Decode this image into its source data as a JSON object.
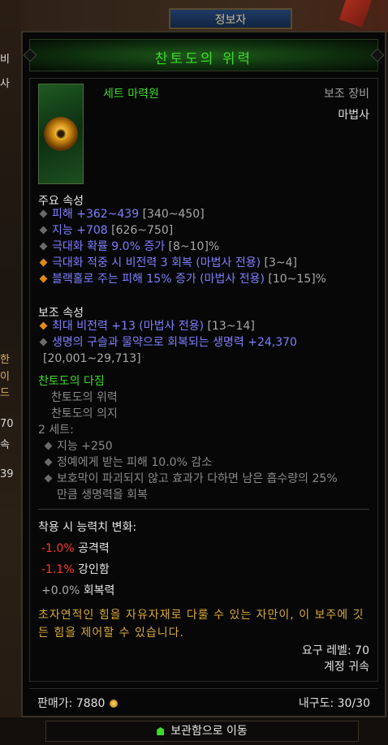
{
  "background": {
    "top_button": "정보자",
    "left_partial": [
      "비",
      "사",
      "한",
      "이",
      "드",
      "70",
      "속",
      "39"
    ]
  },
  "item": {
    "name": "찬토도의 위력",
    "type": "세트 마력원",
    "slot": "보조 장비",
    "class": "마법사"
  },
  "primary": {
    "header": "주요 속성",
    "stats": [
      {
        "value": "피해 +362~439",
        "range": " [340~450]"
      },
      {
        "value": "지능 +708",
        "range": " [626~750]"
      },
      {
        "value": "극대화 확률 9.0% 증가",
        "range": " [8~10]%"
      },
      {
        "value": "극대화 적중 시 비전력 3 회복 (마법사 전용)",
        "range": " [3~4]"
      },
      {
        "value": "블랙홀로 주는 피해 15% 증가 (마법사 전용)",
        "range": " [10~15]%"
      }
    ]
  },
  "secondary": {
    "header": "보조 속성",
    "stats": [
      {
        "value": "최대 비전력 +13 (마법사 전용)",
        "range": " [13~14]"
      },
      {
        "value": "생명의 구슬과 물약으로 회복되는 생명력 +24,370",
        "range": "[20,001~29,713]"
      }
    ]
  },
  "set": {
    "name": "찬토도의 다짐",
    "pieces": [
      "찬토도의 위력",
      "찬토도의 의지"
    ],
    "bonus_label": "2 세트:",
    "bonuses": [
      "지능 +250",
      "정예에게 받는 피해 10.0% 감소",
      "보호막이 파괴되지 않고 효과가 다하면 남은 흡수량의 25%",
      "만큼 생명력을 회복"
    ]
  },
  "changes": {
    "header": "착용 시 능력치 변화:",
    "rows": [
      {
        "value": "-1.0%",
        "label": " 공격력"
      },
      {
        "value": "-1.1%",
        "label": " 강인함"
      },
      {
        "value": "+0.0%",
        "label": " 회복력"
      }
    ]
  },
  "flavor": "초자연적인 힘을 자유자재로 다룰 수 있는 자만이, 이 보주에 깃든 힘을 제어할 수 있습니다.",
  "requirements": {
    "level": "요구 레벨: 70",
    "bind": "계정 귀속"
  },
  "footer": {
    "price_label": "판매가: ",
    "price_value": "7880",
    "durability": "내구도: 30/30"
  },
  "stash_button": "보관함으로 이동",
  "colors": {
    "set_green": "#3ddc2a",
    "magic_blue": "#7f7fff",
    "negative_red": "#ff3a2a",
    "flavor_gold": "#d8a838"
  }
}
